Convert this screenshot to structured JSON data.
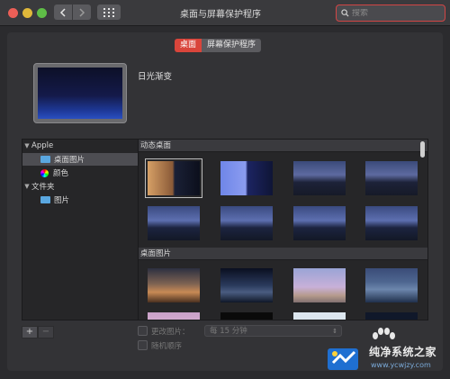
{
  "window": {
    "title": "桌面与屏幕保护程序",
    "search_placeholder": "搜索"
  },
  "tabs": [
    {
      "label": "桌面",
      "active": true
    },
    {
      "label": "屏幕保护程序",
      "active": false
    }
  ],
  "preview": {
    "name": "日光渐变"
  },
  "sidebar": {
    "groups": [
      {
        "label": "Apple",
        "items": [
          {
            "label": "桌面图片",
            "icon": "folder-icon",
            "selected": true
          },
          {
            "label": "颜色",
            "icon": "color-wheel-icon",
            "selected": false
          }
        ]
      },
      {
        "label": "文件夹",
        "items": [
          {
            "label": "图片",
            "icon": "folder-icon",
            "selected": false
          }
        ]
      }
    ]
  },
  "gallery": {
    "sections": [
      {
        "title": "动态桌面"
      },
      {
        "title": "桌面图片"
      }
    ]
  },
  "controls": {
    "add_label": "+",
    "remove_label": "−",
    "change_picture_label": "更改图片：",
    "interval_value": "每 15 分钟",
    "random_order_label": "随机顺序"
  },
  "watermark": {
    "brand": "纯净系统之家",
    "url": "www.ycwjzy.com"
  },
  "colors": {
    "accent": "#d9453b",
    "search_focus": "#d24545"
  }
}
